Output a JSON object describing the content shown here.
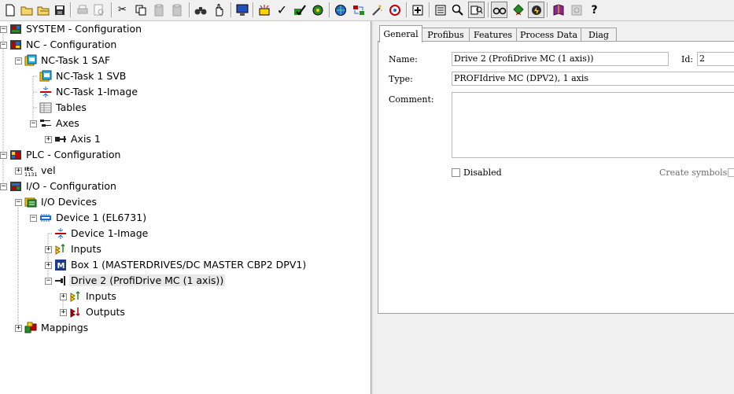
{
  "toolbar": {
    "buttons": [
      {
        "name": "new-file-icon",
        "glyph": "🗋"
      },
      {
        "name": "open-folder-icon",
        "glyph": "📂"
      },
      {
        "name": "open-icon",
        "glyph": "📂"
      },
      {
        "name": "save-icon",
        "glyph": "💾"
      },
      {
        "name": "print-icon",
        "glyph": "🖶"
      },
      {
        "name": "print-preview-icon",
        "glyph": "🔍"
      },
      {
        "name": "cut-icon",
        "glyph": "✂"
      },
      {
        "name": "copy-icon",
        "glyph": "⧉"
      },
      {
        "name": "paste-icon",
        "glyph": "📋"
      },
      {
        "name": "paste-with-links-icon",
        "glyph": "📋"
      },
      {
        "name": "find-icon",
        "glyph": "🔭"
      },
      {
        "name": "find-next-icon",
        "glyph": "✋"
      },
      {
        "name": "monitor-icon",
        "glyph": "🖥"
      },
      {
        "name": "generate-mappings-icon",
        "glyph": "▦"
      },
      {
        "name": "check-configuration-icon",
        "glyph": "✓"
      },
      {
        "name": "activate-configuration-icon",
        "glyph": "✔"
      },
      {
        "name": "set-run-mode-icon",
        "glyph": "⚙"
      },
      {
        "name": "network-icon",
        "glyph": "🌐"
      },
      {
        "name": "restart-icon",
        "glyph": "⇄"
      },
      {
        "name": "magic-wand-icon",
        "glyph": "✨"
      },
      {
        "name": "target-icon",
        "glyph": "◎"
      },
      {
        "name": "add-item-icon",
        "glyph": "✚"
      },
      {
        "name": "list-view-icon",
        "glyph": "☰"
      },
      {
        "name": "zoom-icon",
        "glyph": "🔍"
      },
      {
        "name": "online-view-icon",
        "glyph": "⇋"
      },
      {
        "name": "glasses-icon",
        "glyph": "👓"
      },
      {
        "name": "tree-diamond-icon",
        "glyph": "◆"
      },
      {
        "name": "show-online-icon",
        "glyph": "⚡"
      },
      {
        "name": "book-icon",
        "glyph": "📕"
      },
      {
        "name": "settings-icon",
        "glyph": "⚙"
      },
      {
        "name": "help-icon",
        "glyph": "?"
      }
    ]
  },
  "tree": {
    "items": [
      {
        "name": "tree-item-system",
        "label": "SYSTEM - Configuration",
        "icon": "system-icon"
      },
      {
        "name": "tree-item-nc",
        "label": "NC - Configuration",
        "icon": "nc-config-icon"
      },
      {
        "name": "tree-item-nc-task-saf",
        "label": "NC-Task 1 SAF",
        "icon": "task-icon"
      },
      {
        "name": "tree-item-nc-task-svb",
        "label": "NC-Task 1 SVB",
        "icon": "task-icon"
      },
      {
        "name": "tree-item-nc-task-image",
        "label": "NC-Task 1-Image",
        "icon": "image-icon"
      },
      {
        "name": "tree-item-tables",
        "label": "Tables",
        "icon": "table-icon"
      },
      {
        "name": "tree-item-axes",
        "label": "Axes",
        "icon": "axes-icon"
      },
      {
        "name": "tree-item-axis-1",
        "label": "Axis 1",
        "icon": "axis-icon"
      },
      {
        "name": "tree-item-plc",
        "label": "PLC - Configuration",
        "icon": "plc-config-icon"
      },
      {
        "name": "tree-item-vel",
        "label": "vel",
        "icon": "iec-icon"
      },
      {
        "name": "tree-item-io",
        "label": "I/O - Configuration",
        "icon": "io-config-icon"
      },
      {
        "name": "tree-item-io-devices",
        "label": "I/O Devices",
        "icon": "io-devices-icon"
      },
      {
        "name": "tree-item-device-1",
        "label": "Device 1 (EL6731)",
        "icon": "profibus-device-icon"
      },
      {
        "name": "tree-item-device-1-image",
        "label": "Device 1-Image",
        "icon": "image-icon"
      },
      {
        "name": "tree-item-inputs",
        "label": "Inputs",
        "icon": "inputs-icon"
      },
      {
        "name": "tree-item-box-1",
        "label": "Box 1 (MASTERDRIVES/DC MASTER CBP2 DPV1)",
        "icon": "box-icon"
      },
      {
        "name": "tree-item-drive-2",
        "label": "Drive 2 (ProfiDrive MC (1 axis))",
        "icon": "drive-icon"
      },
      {
        "name": "tree-item-drive-inputs",
        "label": "Inputs",
        "icon": "inputs-icon"
      },
      {
        "name": "tree-item-drive-outputs",
        "label": "Outputs",
        "icon": "outputs-icon"
      },
      {
        "name": "tree-item-mappings",
        "label": "Mappings",
        "icon": "mappings-icon"
      }
    ]
  },
  "details": {
    "tabs": [
      "General",
      "Profibus",
      "Features",
      "Process Data",
      "Diag"
    ],
    "active_tab": "General",
    "name_label": "Name:",
    "name_value": "Drive 2 (ProfiDrive MC (1 axis))",
    "id_label": "Id:",
    "id_value": "2",
    "type_label": "Type:",
    "type_value": "PROFIdrive MC (DPV2), 1 axis",
    "comment_label": "Comment:",
    "comment_value": "",
    "disabled_label": "Disabled",
    "disabled_checked": false,
    "create_symbols_label": "Create symbols",
    "create_symbols_checked": false
  },
  "colors": {
    "selection": "#e8e8e8",
    "window": "#f0f0f0",
    "panel": "#ffffff"
  }
}
